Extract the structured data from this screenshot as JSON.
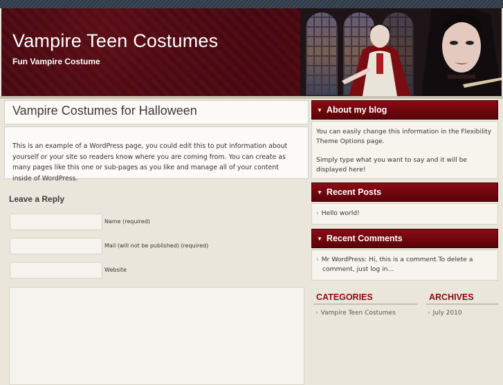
{
  "header": {
    "site_title": "Vampire Teen Costumes",
    "site_description": "Fun Vampire Costume"
  },
  "page": {
    "title": "Vampire Costumes for Halloween",
    "body": "This is an example of a WordPress page, you could edit this to put information about yourself or your site so readers know where you are coming from. You can create as many pages like this one or sub-pages as you like and manage all of your content inside of WordPress."
  },
  "reply": {
    "heading": "Leave a Reply",
    "name_label": "Name (required)",
    "mail_label": "Mail (will not be published) (required)",
    "website_label": "Website"
  },
  "sidebar": {
    "about": {
      "heading": "About my blog",
      "text1": "You can easily change this information in the Flexibility Theme Options page.",
      "text2": "Simply type what you want to say and it will be displayed here!"
    },
    "recent_posts": {
      "heading": "Recent Posts",
      "items": [
        "Hello world!"
      ]
    },
    "recent_comments": {
      "heading": "Recent Comments",
      "items": [
        "Mr WordPress: Hi, this is a comment.To delete a comment, just log in..."
      ]
    },
    "categories": {
      "heading": "CATEGORIES",
      "items": [
        "Vampire Teen Costumes"
      ]
    },
    "archives": {
      "heading": "ARCHIVES",
      "items": [
        "July 2010"
      ]
    }
  },
  "colors": {
    "accent": "#8a0b15",
    "header_bg": "#460b13",
    "page_bg": "#ebe6dc"
  }
}
